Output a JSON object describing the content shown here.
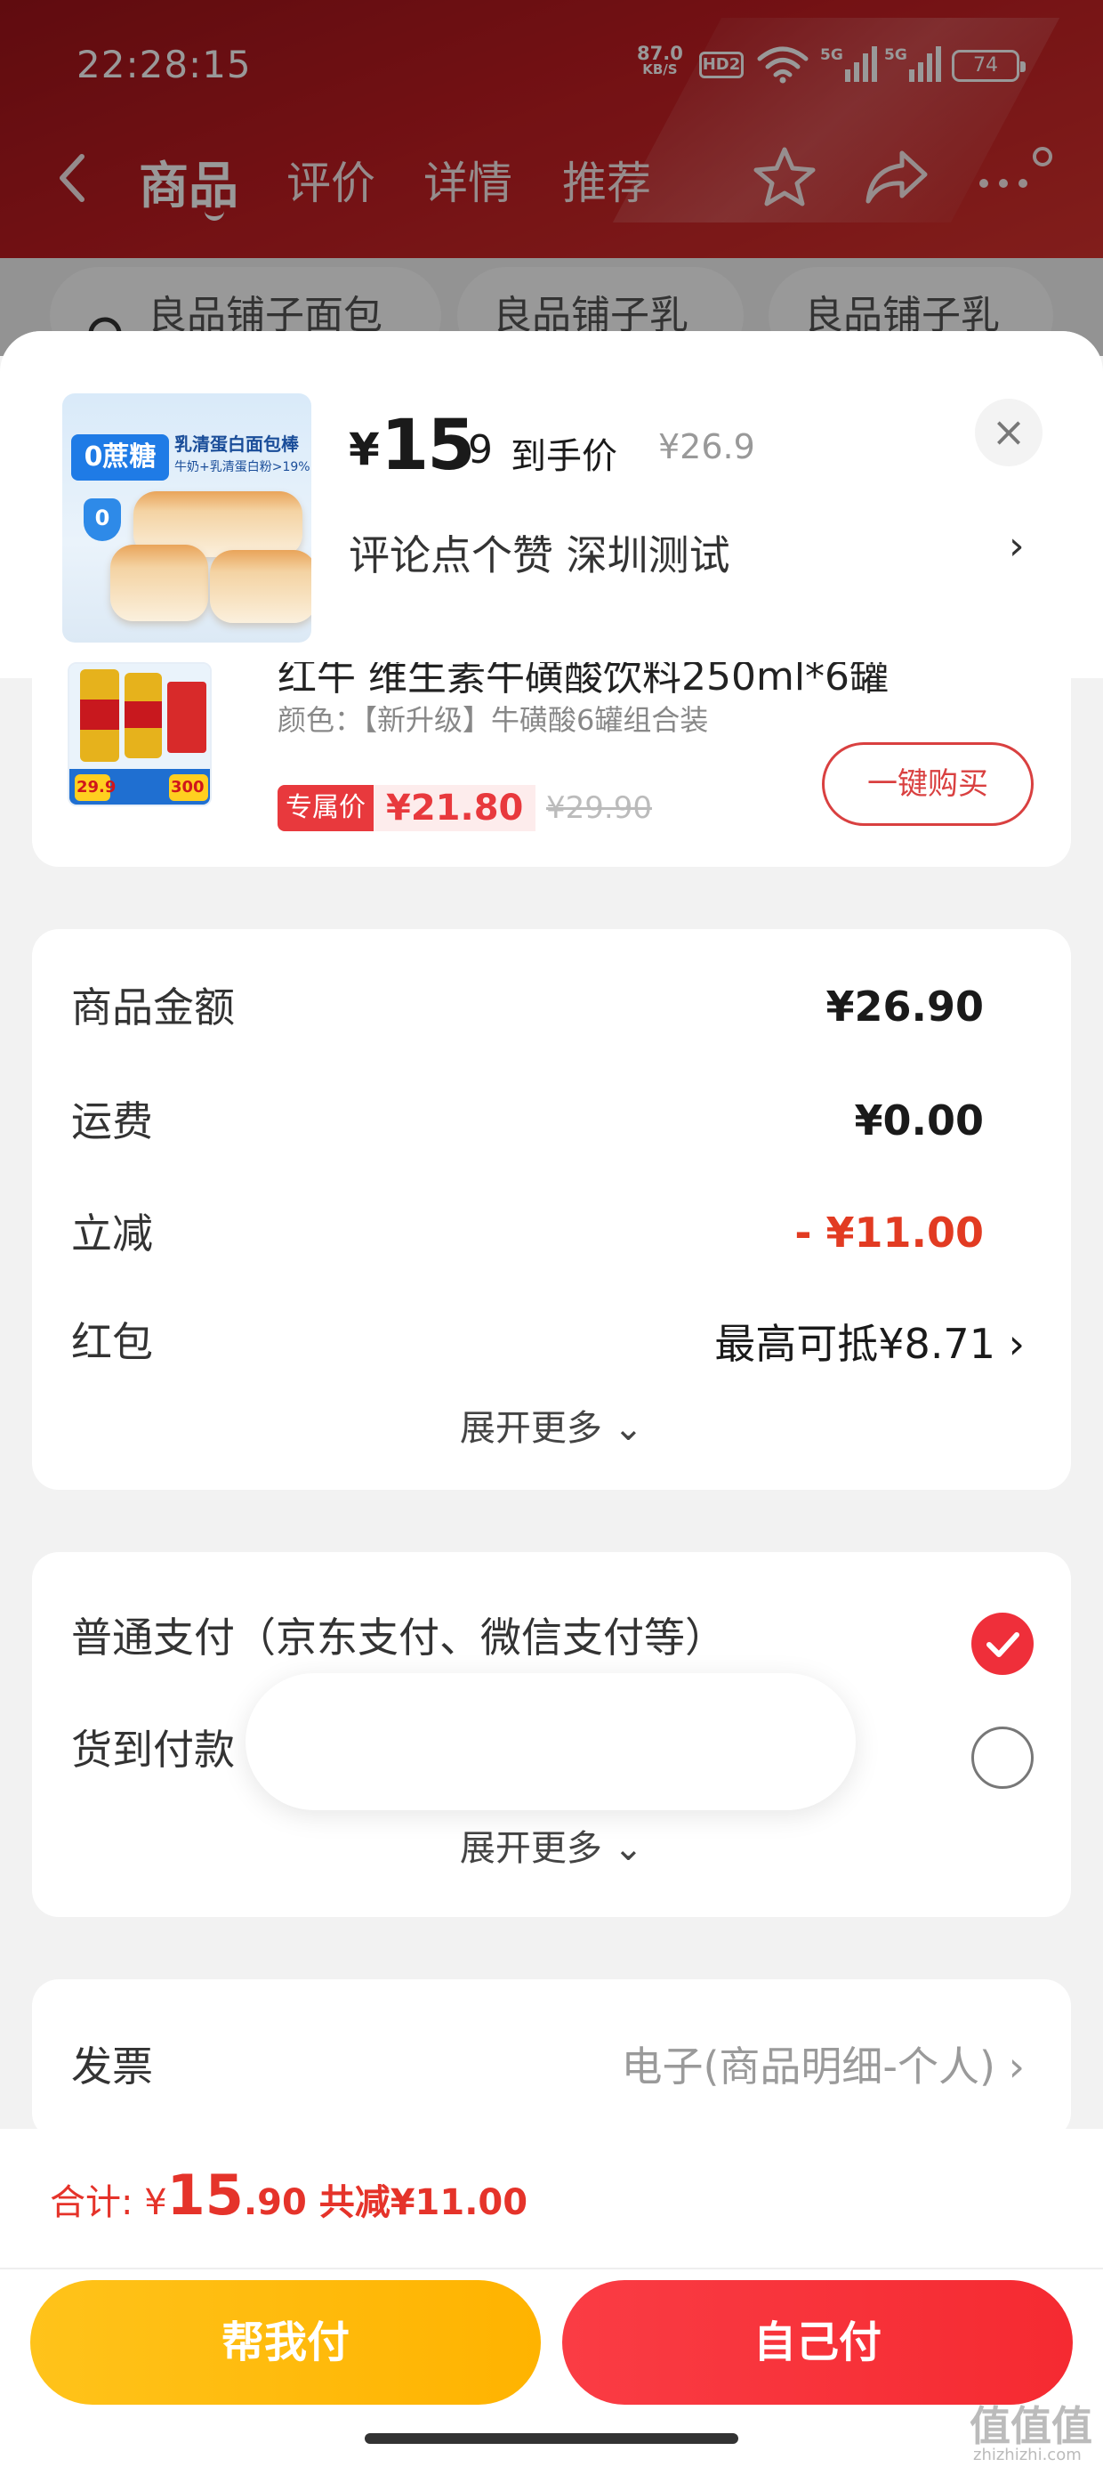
{
  "status_bar": {
    "time": "22:28:15",
    "net_speed": "87.0",
    "net_unit": "KB/S",
    "hd_badge": "HD2",
    "battery": "74"
  },
  "nav": {
    "tabs": [
      "商品",
      "评价",
      "详情",
      "推荐"
    ]
  },
  "chips": [
    "良品铺子面包",
    "良品铺子乳",
    "良品铺子乳"
  ],
  "sheet": {
    "thumb": {
      "badge": "0蔗糖",
      "title": "乳清蛋白面包棒",
      "subtitle": "牛奶+乳清蛋白粉>19%",
      "mark": "0"
    },
    "price_currency": "¥",
    "price_int": "15",
    "price_dec": ".9",
    "price_label": "到手价",
    "price_original": "¥26.9",
    "close_icon": "×",
    "promo": "评论点个赞  深圳测试",
    "promo_chevron": "›"
  },
  "recommend_item": {
    "name": "红牛 维生素牛磺酸饮料250ml*6罐",
    "spec": "颜色：【新升级】牛磺酸6罐组合装",
    "tag": "专属价",
    "price": "¥21.80",
    "original_price": "¥29.90",
    "buy_label": "一键购买",
    "img_price_left": "29.9",
    "img_price_right": "300"
  },
  "amounts": {
    "rows": [
      {
        "label": "商品金额",
        "value": "¥26.90"
      },
      {
        "label": "运费",
        "value": "¥0.00"
      },
      {
        "label": "立减",
        "value": "- ¥11.00"
      },
      {
        "label": "红包",
        "value": "最高可抵¥8.71 ›"
      }
    ],
    "expand": "展开更多 ⌄"
  },
  "payment": {
    "options": [
      {
        "label": "普通支付（京东支付、微信支付等）",
        "selected": true
      },
      {
        "label": "货到付款",
        "selected": false
      }
    ],
    "expand": "展开更多 ⌄"
  },
  "invoice": {
    "label": "发票",
    "value": "电子(商品明细-个人) ›"
  },
  "bottom": {
    "total_label": "合计: ¥",
    "total_int": "15",
    "total_dec": ".90",
    "total_save": " 共减¥11.00",
    "help_pay": "帮我付",
    "self_pay": "自己付"
  },
  "watermark": {
    "text": "值值值",
    "sub": "zhizhizhi.com"
  },
  "colors": {
    "brand_red": "#e8393d",
    "total_red": "#e5332a",
    "help_pay": "#ffc31a",
    "self_pay": "#f52a31"
  }
}
